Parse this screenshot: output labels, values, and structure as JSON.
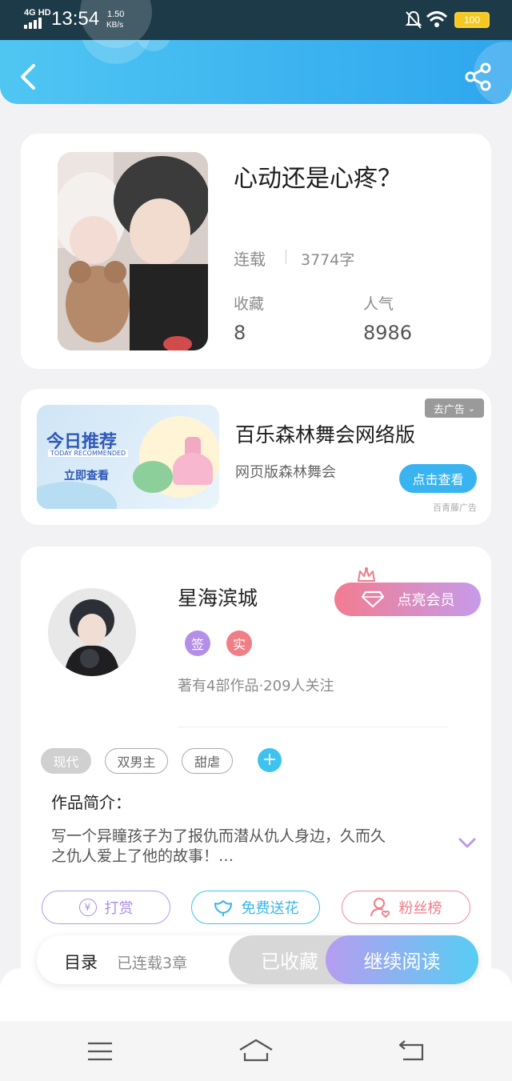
{
  "status_bar": {
    "network": "4G HD",
    "time": "13:54",
    "speed_value": "1.50",
    "speed_unit": "KB/s",
    "battery": "100"
  },
  "book": {
    "title": "心动还是心疼？",
    "status": "连载",
    "word_count": "3774字",
    "favorites_label": "收藏",
    "favorites_value": "8",
    "popularity_label": "人气",
    "popularity_value": "8986"
  },
  "ad": {
    "close_label": "去广告",
    "banner_title": "今日推荐",
    "banner_subtitle": "TODAY RECOMMENDED",
    "banner_cta": "立即查看",
    "title": "百乐森林舞会网络版",
    "subtitle": "网页版森林舞会",
    "button": "点击查看",
    "source": "百青藤广告"
  },
  "author": {
    "name": "星海滨城",
    "vip_button": "点亮会员",
    "badge_signed": "签",
    "badge_real": "实",
    "stats": "著有4部作品·209人关注"
  },
  "tags": [
    "现代",
    "双男主",
    "甜虐"
  ],
  "intro": {
    "heading": "作品简介：",
    "text_line1": "写一个异瞳孩子为了报仇而潜从仇人身边，久而久",
    "text_line2": "之仇人爱上了他的故事！…"
  },
  "actions": {
    "reward": "打赏",
    "flower": "免费送花",
    "fans": "粉丝榜"
  },
  "bottom_bar": {
    "catalog": "目录",
    "chapters": "已连载3章",
    "collected": "已收藏",
    "continue": "继续阅读"
  },
  "colors": {
    "accent_blue": "#39b4f0",
    "vip_pink": "#f27c90",
    "purple": "#a98ee8",
    "continue_gradient_start": "#b79cf0",
    "continue_gradient_end": "#56cdf3"
  }
}
